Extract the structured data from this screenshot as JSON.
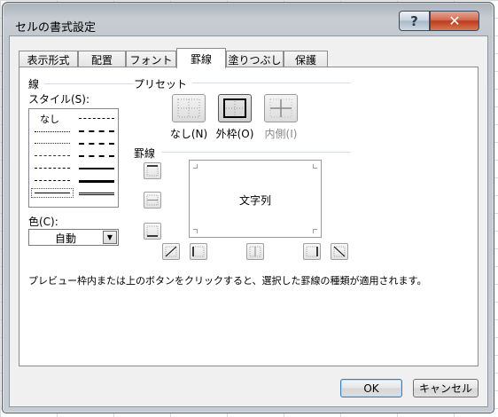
{
  "dialog": {
    "title": "セルの書式設定",
    "help_glyph": "?",
    "close_glyph": "✕"
  },
  "tabs": [
    {
      "label": "表示形式"
    },
    {
      "label": "配置"
    },
    {
      "label": "フォント"
    },
    {
      "label": "罫線",
      "active": true
    },
    {
      "label": "塗りつぶし"
    },
    {
      "label": "保護"
    }
  ],
  "line_group": {
    "title": "線",
    "style_label": "スタイル(S):",
    "none_label": "なし",
    "color_label": "色(C):",
    "color_value": "自動"
  },
  "presets": {
    "title": "プリセット",
    "none_label": "なし(N)",
    "outline_label": "外枠(O)",
    "inside_label": "内側(I)"
  },
  "border": {
    "title": "罫線",
    "preview_text": "文字列"
  },
  "hint_text": "プレビュー枠内または上のボタンをクリックすると、選択した罫線の種類が適用されます。",
  "buttons": {
    "ok": "OK",
    "cancel": "キャンセル"
  },
  "colors": {
    "close_red": "#c9452a",
    "accent_blue": "#3c7fb1"
  }
}
